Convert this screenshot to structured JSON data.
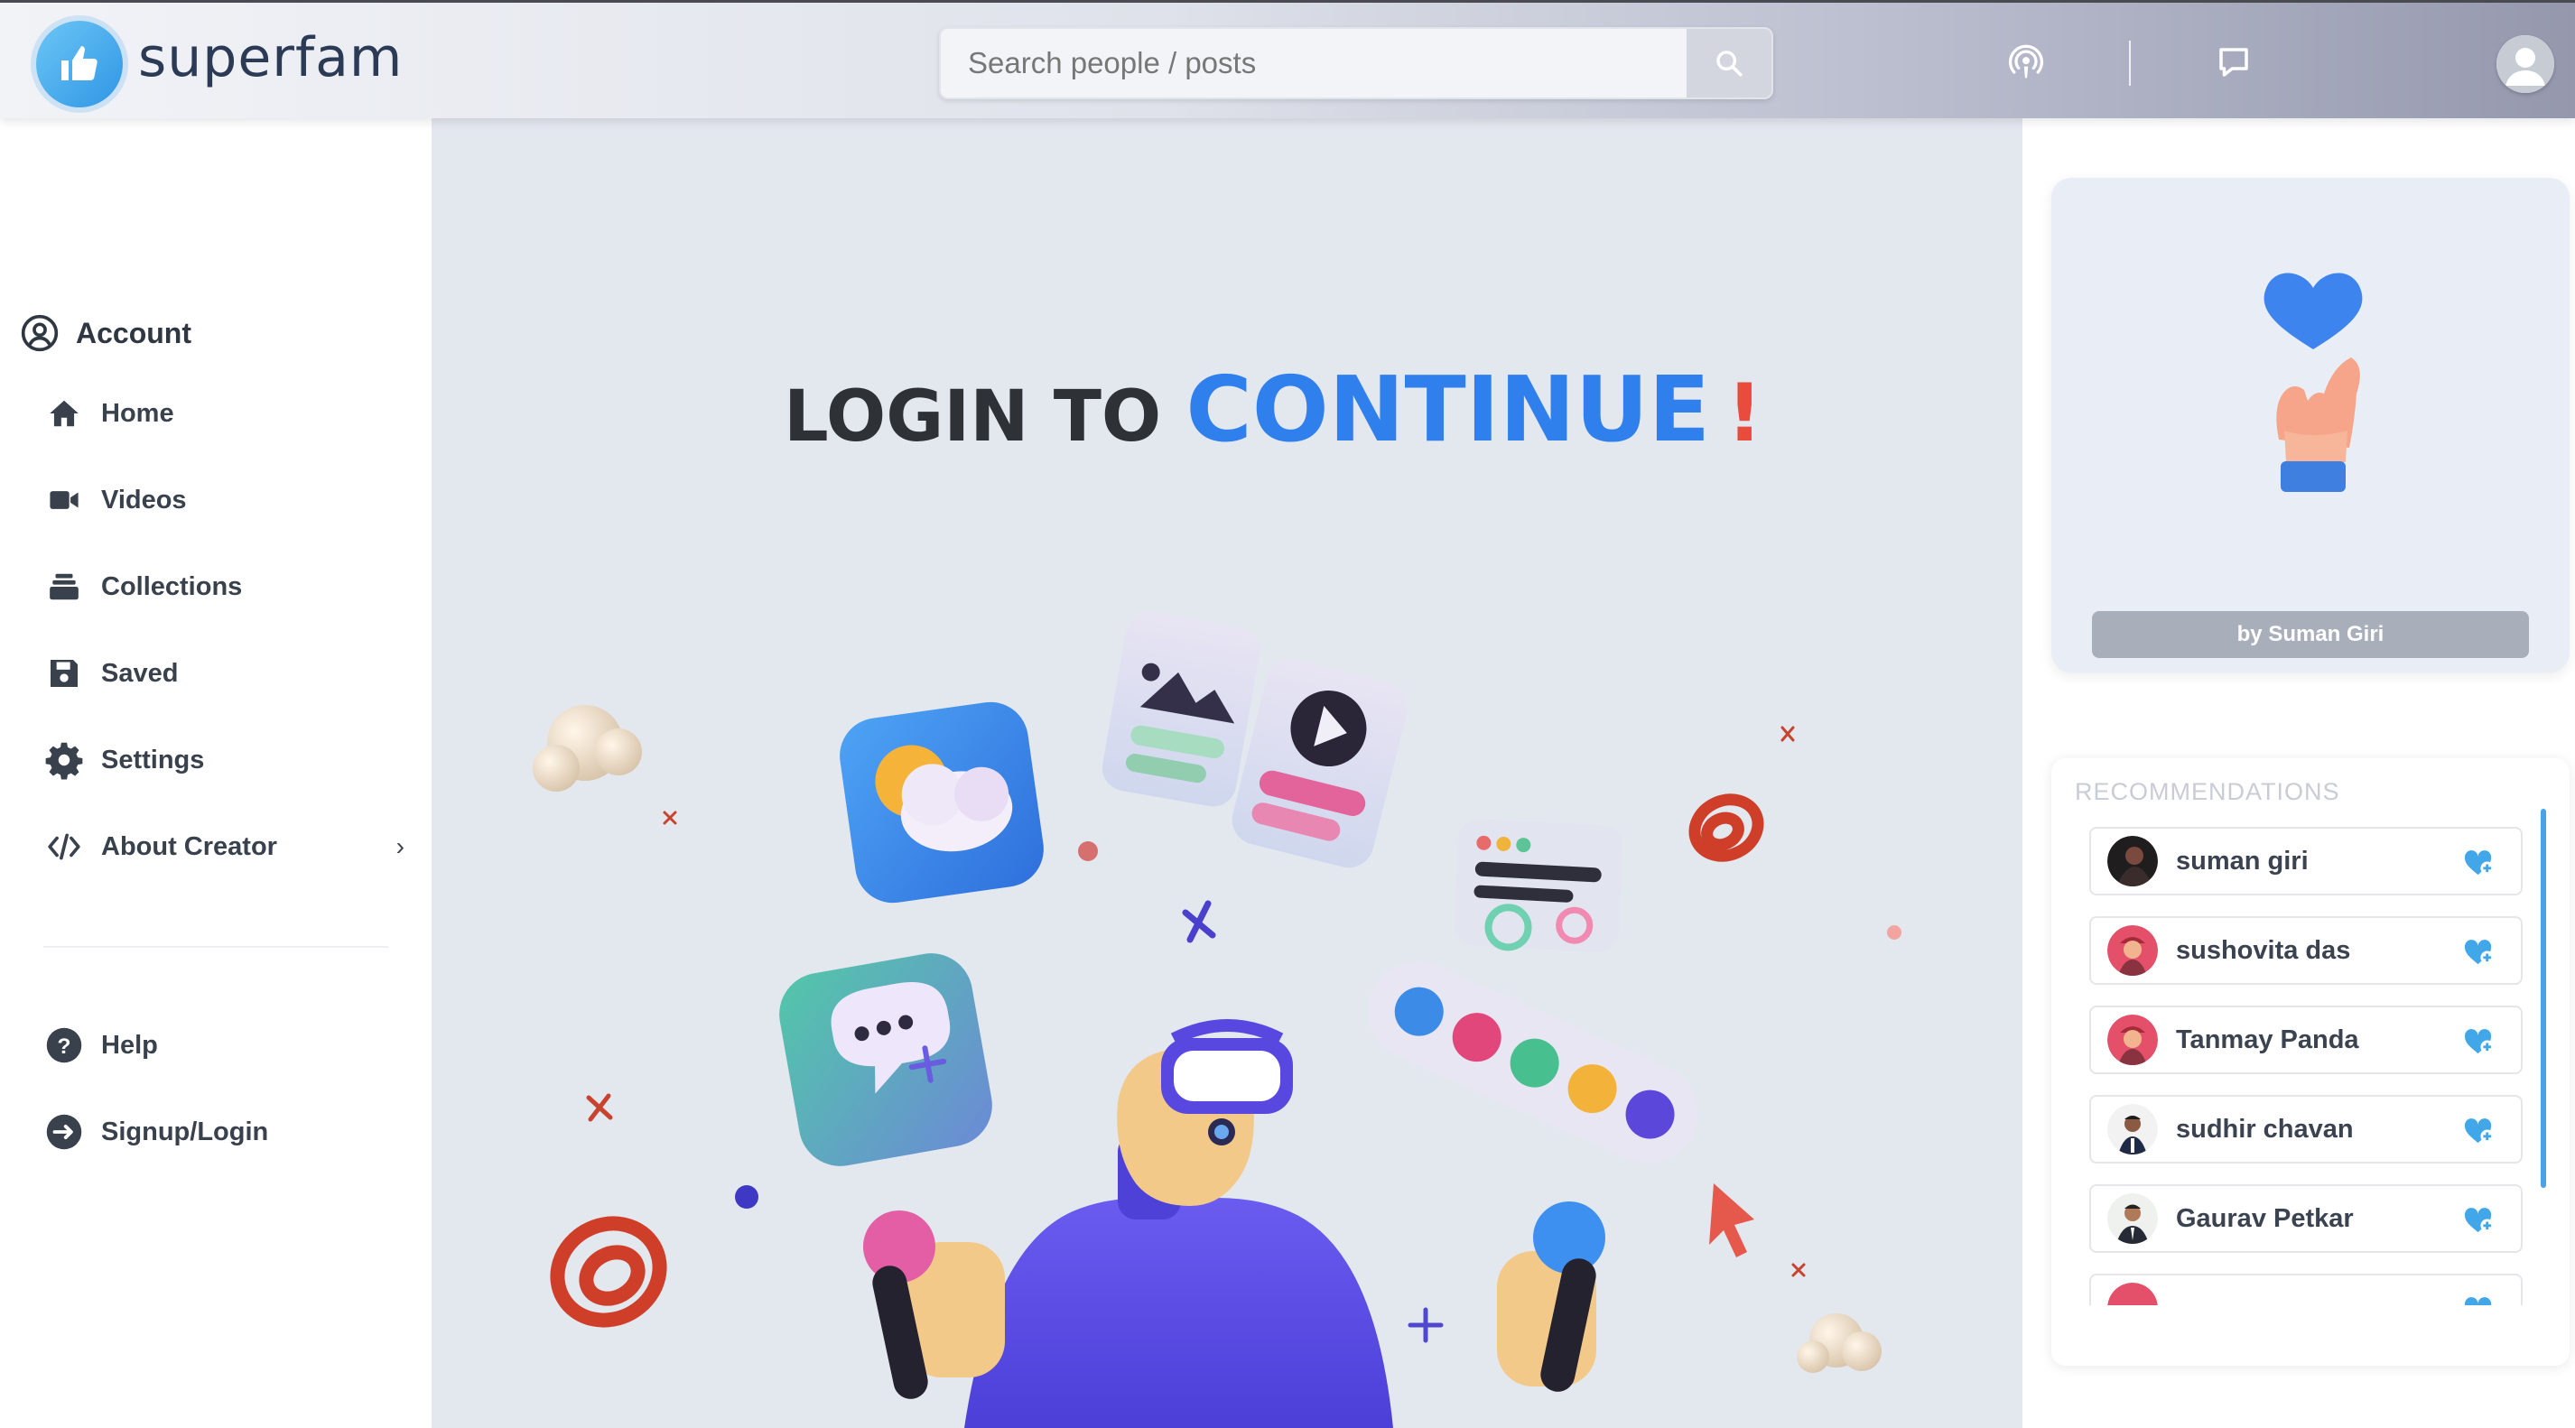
{
  "brand": {
    "name": "superfam",
    "accent": "#2f80ed"
  },
  "search": {
    "placeholder": "Search people / posts"
  },
  "topbar": {
    "icons": [
      "podcast-icon",
      "message-icon",
      "user-avatar-icon"
    ]
  },
  "sidebar": {
    "account_label": "Account",
    "items": [
      {
        "label": "Home",
        "icon": "home-icon"
      },
      {
        "label": "Videos",
        "icon": "video-icon"
      },
      {
        "label": "Collections",
        "icon": "collections-icon"
      },
      {
        "label": "Saved",
        "icon": "save-icon"
      },
      {
        "label": "Settings",
        "icon": "gear-icon"
      },
      {
        "label": "About Creator",
        "icon": "code-icon",
        "chevron": "›"
      }
    ],
    "bottom_items": [
      {
        "label": "Help",
        "icon": "help-icon"
      },
      {
        "label": "Signup/Login",
        "icon": "signin-icon"
      }
    ]
  },
  "main": {
    "headline_part1": "LOGIN TO ",
    "headline_part2": "CONTINUE",
    "headline_part3": "!",
    "colors": {
      "dark": "#2e3135",
      "blue": "#2f80ed",
      "red": "#e94b3c"
    }
  },
  "creator_card": {
    "credit": "by Suman Giri"
  },
  "recommendations": {
    "title": "RECOMMENDATIONS",
    "users": [
      {
        "name": "suman giri"
      },
      {
        "name": "sushovita das"
      },
      {
        "name": "Tanmay Panda"
      },
      {
        "name": "sudhir chavan"
      },
      {
        "name": "Gaurav Petkar"
      },
      {
        "name": ""
      }
    ]
  }
}
